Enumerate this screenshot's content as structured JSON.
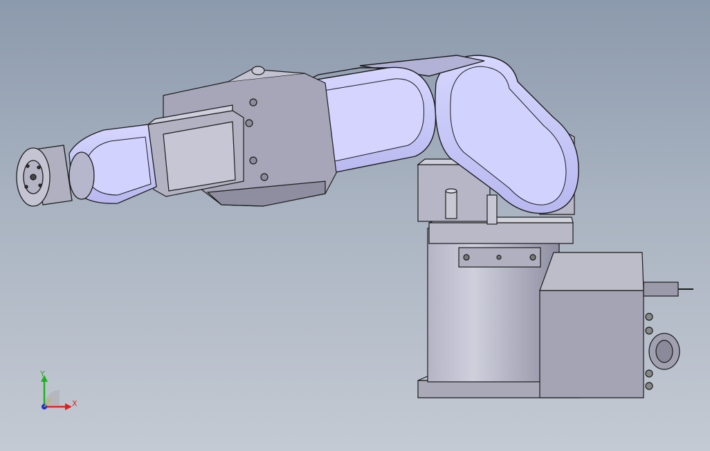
{
  "viewport": {
    "background_top": "#8c9aad",
    "background_bottom": "#c4cad3"
  },
  "model": {
    "body_color": "#c9c9ff",
    "metal_color": "#9a9aa8",
    "edge_color": "#202020"
  },
  "triad": {
    "x_label": "X",
    "y_label": "Y",
    "x_color": "#e02020",
    "y_color": "#20b020",
    "z_color": "#2030d0"
  }
}
